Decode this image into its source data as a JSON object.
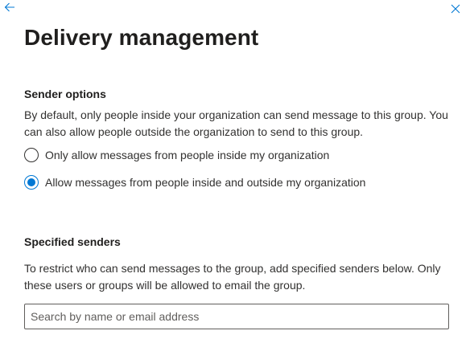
{
  "header": {
    "back_icon": "arrow-left-icon",
    "close_icon": "close-icon",
    "title": "Delivery management"
  },
  "sender_options": {
    "heading": "Sender options",
    "description": "By default, only people inside your organization can send message to this group. You can also allow people outside the organization to send to this group.",
    "options": [
      {
        "label": "Only allow messages from people inside my organization",
        "selected": false
      },
      {
        "label": "Allow messages from people inside and outside my organization",
        "selected": true
      }
    ]
  },
  "specified_senders": {
    "heading": "Specified senders",
    "description": "To restrict who can send messages to the group, add specified senders below. Only these users or groups will be allowed to email the group.",
    "search": {
      "value": "",
      "placeholder": "Search by name or email address"
    }
  },
  "colors": {
    "accent": "#0078d4",
    "text": "#323130",
    "title": "#201f1e"
  }
}
